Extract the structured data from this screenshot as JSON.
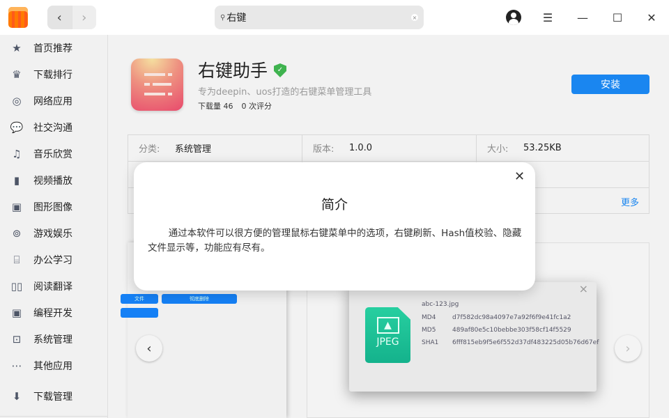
{
  "titlebar": {
    "back": "‹",
    "forward": "›",
    "search_value": "右键",
    "window_buttons": {
      "menu": "☰",
      "minimize": "—",
      "maximize": "☐",
      "close": "✕"
    }
  },
  "sidebar": {
    "items": [
      {
        "label": "首页推荐",
        "icon": "star-icon",
        "glyph": "★"
      },
      {
        "label": "下载排行",
        "icon": "crown-icon",
        "glyph": "♛"
      },
      {
        "label": "网络应用",
        "icon": "globe-icon",
        "glyph": "◎"
      },
      {
        "label": "社交沟通",
        "icon": "chat-icon",
        "glyph": "💬"
      },
      {
        "label": "音乐欣赏",
        "icon": "music-icon",
        "glyph": "♫"
      },
      {
        "label": "视频播放",
        "icon": "film-icon",
        "glyph": "▮"
      },
      {
        "label": "图形图像",
        "icon": "image-icon",
        "glyph": "▣"
      },
      {
        "label": "游戏娱乐",
        "icon": "gamepad-icon",
        "glyph": "⊚"
      },
      {
        "label": "办公学习",
        "icon": "presentation-icon",
        "glyph": "⌸"
      },
      {
        "label": "阅读翻译",
        "icon": "book-icon",
        "glyph": "▯▯"
      },
      {
        "label": "编程开发",
        "icon": "terminal-icon",
        "glyph": "▣"
      },
      {
        "label": "系统管理",
        "icon": "system-icon",
        "glyph": "⊡"
      },
      {
        "label": "其他应用",
        "icon": "more-icon",
        "glyph": "⋯"
      }
    ],
    "download_manager": {
      "label": "下载管理",
      "icon": "download-icon",
      "glyph": "⬇"
    }
  },
  "app": {
    "name": "右键助手",
    "tagline": "专为deepin、uos打造的右键菜单管理工具",
    "downloads": "下载量 46",
    "ratings": "0 次评分",
    "install": "安装"
  },
  "info": {
    "category_label": "分类:",
    "category": "系统管理",
    "version_label": "版本:",
    "version": "1.0.0",
    "size_label": "大小:",
    "size": "53.25KB",
    "more": "更多"
  },
  "screenshot": {
    "buttons": [
      "文件",
      "彻底删除"
    ],
    "filename": "abc-123.jpg",
    "hashes": [
      {
        "k": "MD4",
        "v": "d7f582dc98a4097e7a92f6f9e41fc1a2"
      },
      {
        "k": "MD5",
        "v": "489af80e5c10bebbe303f58cf14f5529"
      },
      {
        "k": "SHA1",
        "v": "6fff815eb9f5e6f552d37df483225d05b76d67ef"
      }
    ],
    "icon_label": "JPEG",
    "close": "×"
  },
  "dialog": {
    "title": "简介",
    "body": "通过本软件可以很方便的管理鼠标右键菜单中的选项，右键刷新、Hash值校验、隐藏文件显示等，功能应有尽有。",
    "close": "✕"
  }
}
